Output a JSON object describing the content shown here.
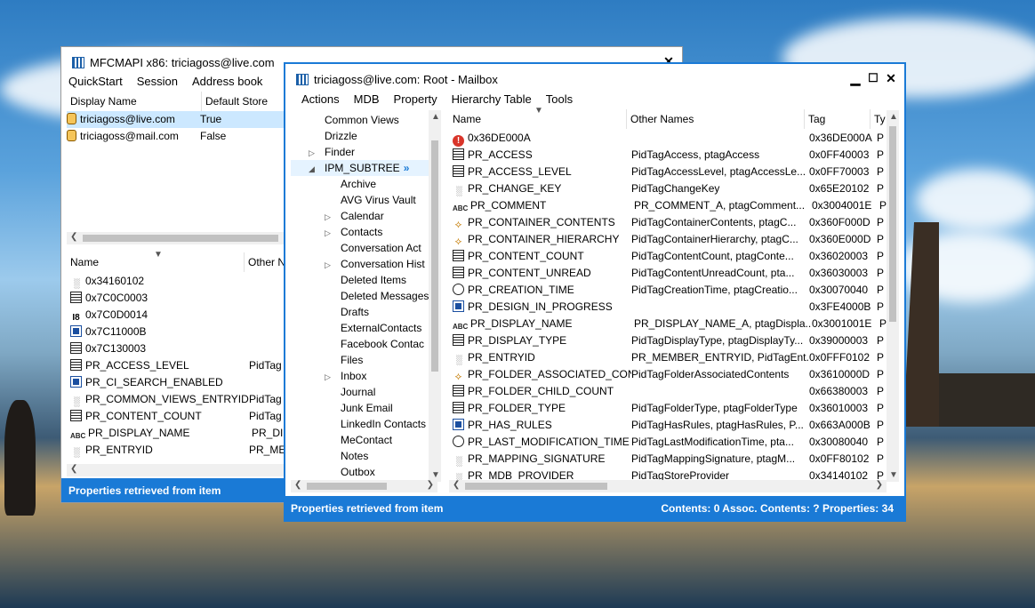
{
  "main_window": {
    "title": "MFCMAPI x86: triciagoss@live.com",
    "menu": [
      "QuickStart",
      "Session",
      "Address book"
    ],
    "columns": [
      "Display Name",
      "Default Store"
    ],
    "stores": [
      {
        "name": "triciagoss@live.com",
        "default": "True"
      },
      {
        "name": "triciagoss@mail.com",
        "default": "False"
      }
    ],
    "prop_columns": [
      "Name",
      "Other N"
    ],
    "props": [
      {
        "icon": "bin",
        "name": "0x34160102",
        "other": ""
      },
      {
        "icon": "int",
        "name": "0x7C0C0003",
        "other": ""
      },
      {
        "icon": "i8",
        "name": "0x7C0D0014",
        "other": ""
      },
      {
        "icon": "bool",
        "name": "0x7C11000B",
        "other": ""
      },
      {
        "icon": "int",
        "name": "0x7C130003",
        "other": ""
      },
      {
        "icon": "int",
        "name": "PR_ACCESS_LEVEL",
        "other": "PidTag"
      },
      {
        "icon": "bool",
        "name": "PR_CI_SEARCH_ENABLED",
        "other": ""
      },
      {
        "icon": "bin",
        "name": "PR_COMMON_VIEWS_ENTRYID",
        "other": "PidTag"
      },
      {
        "icon": "int",
        "name": "PR_CONTENT_COUNT",
        "other": "PidTag"
      },
      {
        "icon": "str",
        "name": "PR_DISPLAY_NAME",
        "other": "PR_DIS"
      },
      {
        "icon": "bin",
        "name": "PR_ENTRYID",
        "other": "PR_ME"
      }
    ],
    "status": "Properties retrieved from item"
  },
  "folder_window": {
    "title": "triciagoss@live.com: Root - Mailbox",
    "menu": [
      "Actions",
      "MDB",
      "Property",
      "Hierarchy Table",
      "Tools"
    ],
    "tree": [
      {
        "label": "Common Views",
        "level": 1,
        "exp": ""
      },
      {
        "label": "Drizzle",
        "level": 1,
        "exp": ""
      },
      {
        "label": "Finder",
        "level": 1,
        "exp": "▷"
      },
      {
        "label": "IPM_SUBTREE",
        "level": 1,
        "exp": "◢",
        "selected": true,
        "badge": "»"
      },
      {
        "label": "Archive",
        "level": 2,
        "exp": ""
      },
      {
        "label": "AVG Virus Vault",
        "level": 2,
        "exp": ""
      },
      {
        "label": "Calendar",
        "level": 2,
        "exp": "▷"
      },
      {
        "label": "Contacts",
        "level": 2,
        "exp": "▷"
      },
      {
        "label": "Conversation Act",
        "level": 2,
        "exp": ""
      },
      {
        "label": "Conversation Hist",
        "level": 2,
        "exp": "▷"
      },
      {
        "label": "Deleted Items",
        "level": 2,
        "exp": ""
      },
      {
        "label": "Deleted Messages",
        "level": 2,
        "exp": ""
      },
      {
        "label": "Drafts",
        "level": 2,
        "exp": ""
      },
      {
        "label": "ExternalContacts",
        "level": 2,
        "exp": ""
      },
      {
        "label": "Facebook Contac",
        "level": 2,
        "exp": ""
      },
      {
        "label": "Files",
        "level": 2,
        "exp": ""
      },
      {
        "label": "Inbox",
        "level": 2,
        "exp": "▷"
      },
      {
        "label": "Journal",
        "level": 2,
        "exp": ""
      },
      {
        "label": "Junk Email",
        "level": 2,
        "exp": ""
      },
      {
        "label": "LinkedIn Contacts",
        "level": 2,
        "exp": ""
      },
      {
        "label": "MeContact",
        "level": 2,
        "exp": ""
      },
      {
        "label": "Notes",
        "level": 2,
        "exp": ""
      },
      {
        "label": "Outbox",
        "level": 2,
        "exp": ""
      }
    ],
    "columns": [
      "Name",
      "Other Names",
      "Tag",
      "Ty"
    ],
    "props": [
      {
        "icon": "err",
        "name": "0x36DE000A",
        "other": "",
        "tag": "0x36DE000A",
        "type": "P"
      },
      {
        "icon": "int",
        "name": "PR_ACCESS",
        "other": "PidTagAccess, ptagAccess",
        "tag": "0x0FF40003",
        "type": "P"
      },
      {
        "icon": "int",
        "name": "PR_ACCESS_LEVEL",
        "other": "PidTagAccessLevel, ptagAccessLe...",
        "tag": "0x0FF70003",
        "type": "P"
      },
      {
        "icon": "bin",
        "name": "PR_CHANGE_KEY",
        "other": "PidTagChangeKey",
        "tag": "0x65E20102",
        "type": "P"
      },
      {
        "icon": "str",
        "name": "PR_COMMENT",
        "other": "PR_COMMENT_A, ptagComment...",
        "tag": "0x3004001E",
        "type": "P"
      },
      {
        "icon": "obj",
        "name": "PR_CONTAINER_CONTENTS",
        "other": "PidTagContainerContents, ptagC...",
        "tag": "0x360F000D",
        "type": "P"
      },
      {
        "icon": "obj",
        "name": "PR_CONTAINER_HIERARCHY",
        "other": "PidTagContainerHierarchy, ptagC...",
        "tag": "0x360E000D",
        "type": "P"
      },
      {
        "icon": "int",
        "name": "PR_CONTENT_COUNT",
        "other": "PidTagContentCount, ptagConte...",
        "tag": "0x36020003",
        "type": "P"
      },
      {
        "icon": "int",
        "name": "PR_CONTENT_UNREAD",
        "other": "PidTagContentUnreadCount, pta...",
        "tag": "0x36030003",
        "type": "P"
      },
      {
        "icon": "time",
        "name": "PR_CREATION_TIME",
        "other": "PidTagCreationTime, ptagCreatio...",
        "tag": "0x30070040",
        "type": "P"
      },
      {
        "icon": "bool",
        "name": "PR_DESIGN_IN_PROGRESS",
        "other": "",
        "tag": "0x3FE4000B",
        "type": "P"
      },
      {
        "icon": "str",
        "name": "PR_DISPLAY_NAME",
        "other": "PR_DISPLAY_NAME_A, ptagDispla...",
        "tag": "0x3001001E",
        "type": "P"
      },
      {
        "icon": "int",
        "name": "PR_DISPLAY_TYPE",
        "other": "PidTagDisplayType, ptagDisplayTy...",
        "tag": "0x39000003",
        "type": "P"
      },
      {
        "icon": "bin",
        "name": "PR_ENTRYID",
        "other": "PR_MEMBER_ENTRYID, PidTagEnt...",
        "tag": "0x0FFF0102",
        "type": "P"
      },
      {
        "icon": "obj",
        "name": "PR_FOLDER_ASSOCIATED_CON...",
        "other": "PidTagFolderAssociatedContents",
        "tag": "0x3610000D",
        "type": "P"
      },
      {
        "icon": "int",
        "name": "PR_FOLDER_CHILD_COUNT",
        "other": "",
        "tag": "0x66380003",
        "type": "P"
      },
      {
        "icon": "int",
        "name": "PR_FOLDER_TYPE",
        "other": "PidTagFolderType, ptagFolderType",
        "tag": "0x36010003",
        "type": "P"
      },
      {
        "icon": "bool",
        "name": "PR_HAS_RULES",
        "other": "PidTagHasRules, ptagHasRules, P...",
        "tag": "0x663A000B",
        "type": "P"
      },
      {
        "icon": "time",
        "name": "PR_LAST_MODIFICATION_TIME",
        "other": "PidTagLastModificationTime, pta...",
        "tag": "0x30080040",
        "type": "P"
      },
      {
        "icon": "bin",
        "name": "PR_MAPPING_SIGNATURE",
        "other": "PidTagMappingSignature, ptagM...",
        "tag": "0x0FF80102",
        "type": "P"
      },
      {
        "icon": "bin",
        "name": "PR_MDB_PROVIDER",
        "other": "PidTagStoreProvider",
        "tag": "0x34140102",
        "type": "P"
      }
    ],
    "status": "Properties retrieved from item",
    "status_right": "Contents: 0 Assoc. Contents: ?   Properties: 34"
  },
  "icons": {
    "int": "",
    "bin": "░",
    "str": "ABC",
    "bool": "",
    "time": "",
    "obj": "⟡",
    "err": "!",
    "i8": "I8",
    "db": ""
  },
  "colors": {
    "status": "#1a7ad6",
    "selection": "#cce8ff",
    "title_active_border": "#1a7ad6"
  }
}
